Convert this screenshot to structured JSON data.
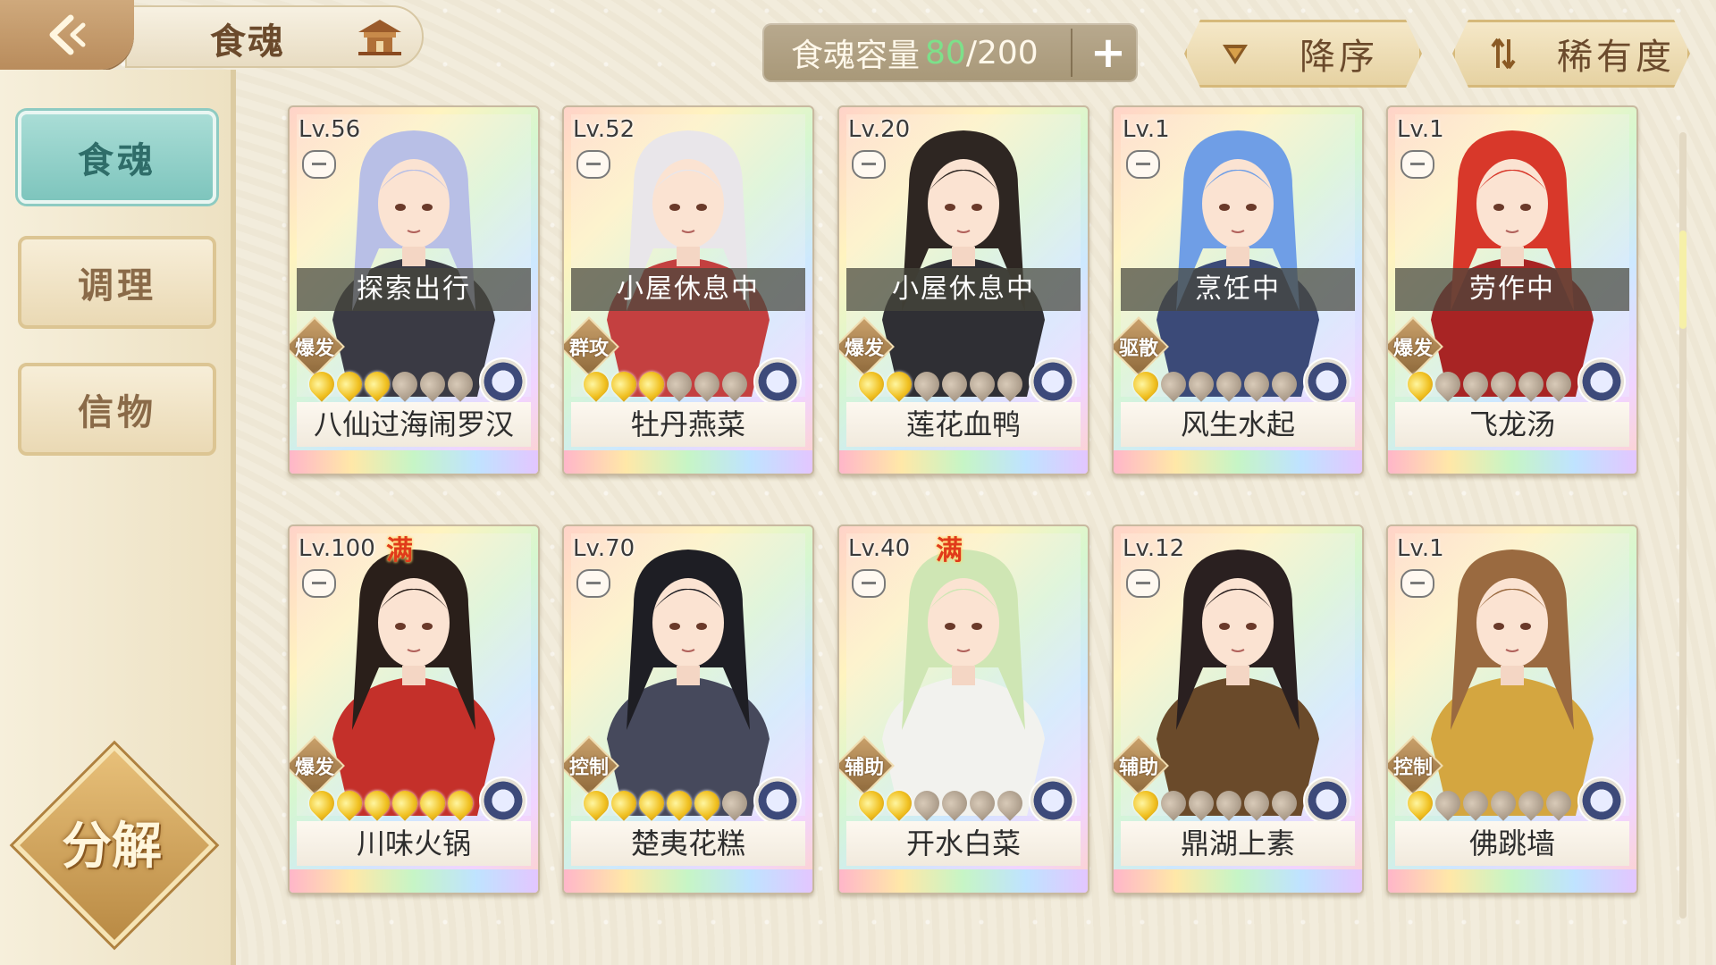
{
  "header": {
    "title": "食魂",
    "capacity_label": "食魂容量",
    "capacity_current": "80",
    "capacity_max": "/200",
    "add_label": "+",
    "sort_order_label": "降序",
    "sort_by_label": "稀有度"
  },
  "sidebar": {
    "items": [
      {
        "label": "食魂",
        "active": true
      },
      {
        "label": "调理",
        "active": false
      },
      {
        "label": "信物",
        "active": false
      }
    ],
    "decompose_label": "分解"
  },
  "cards": [
    {
      "level": "Lv.56",
      "maxed": false,
      "status": "探索出行",
      "role": "爆发",
      "stars_on": 3,
      "stars_total": 6,
      "name": "八仙过海闹罗汉",
      "hair": "#b8bfe6",
      "outfit": "#3a3a44"
    },
    {
      "level": "Lv.52",
      "maxed": false,
      "status": "小屋休息中",
      "role": "群攻",
      "stars_on": 3,
      "stars_total": 6,
      "name": "牡丹燕菜",
      "hair": "#e9e6ea",
      "outfit": "#c44040"
    },
    {
      "level": "Lv.20",
      "maxed": false,
      "status": "小屋休息中",
      "role": "爆发",
      "stars_on": 2,
      "stars_total": 6,
      "name": "莲花血鸭",
      "hair": "#2e2622",
      "outfit": "#2f2f34"
    },
    {
      "level": "Lv.1",
      "maxed": false,
      "status": "烹饪中",
      "role": "驱散",
      "stars_on": 1,
      "stars_total": 6,
      "name": "风生水起",
      "hair": "#6f9ee6",
      "outfit": "#3b4a78"
    },
    {
      "level": "Lv.1",
      "maxed": false,
      "status": "劳作中",
      "role": "爆发",
      "stars_on": 1,
      "stars_total": 6,
      "name": "飞龙汤",
      "hair": "#d8382a",
      "outfit": "#a82424"
    },
    {
      "level": "Lv.100",
      "maxed": true,
      "status": "",
      "role": "爆发",
      "stars_on": 6,
      "stars_total": 6,
      "name": "川味火锅",
      "hair": "#2a1f1a",
      "outfit": "#c4302a"
    },
    {
      "level": "Lv.70",
      "maxed": false,
      "status": "",
      "role": "控制",
      "stars_on": 5,
      "stars_total": 6,
      "name": "楚夷花糕",
      "hair": "#1e1e24",
      "outfit": "#46495c"
    },
    {
      "level": "Lv.40",
      "maxed": true,
      "status": "",
      "role": "辅助",
      "stars_on": 2,
      "stars_total": 6,
      "name": "开水白菜",
      "hair": "#cfe6b4",
      "outfit": "#f2f2ee"
    },
    {
      "level": "Lv.12",
      "maxed": false,
      "status": "",
      "role": "辅助",
      "stars_on": 1,
      "stars_total": 6,
      "name": "鼎湖上素",
      "hair": "#2a2020",
      "outfit": "#6a4a2a"
    },
    {
      "level": "Lv.1",
      "maxed": false,
      "status": "",
      "role": "控制",
      "stars_on": 1,
      "stars_total": 6,
      "name": "佛跳墙",
      "hair": "#9a6a40",
      "outfit": "#d4a640"
    }
  ],
  "max_badge": "满"
}
